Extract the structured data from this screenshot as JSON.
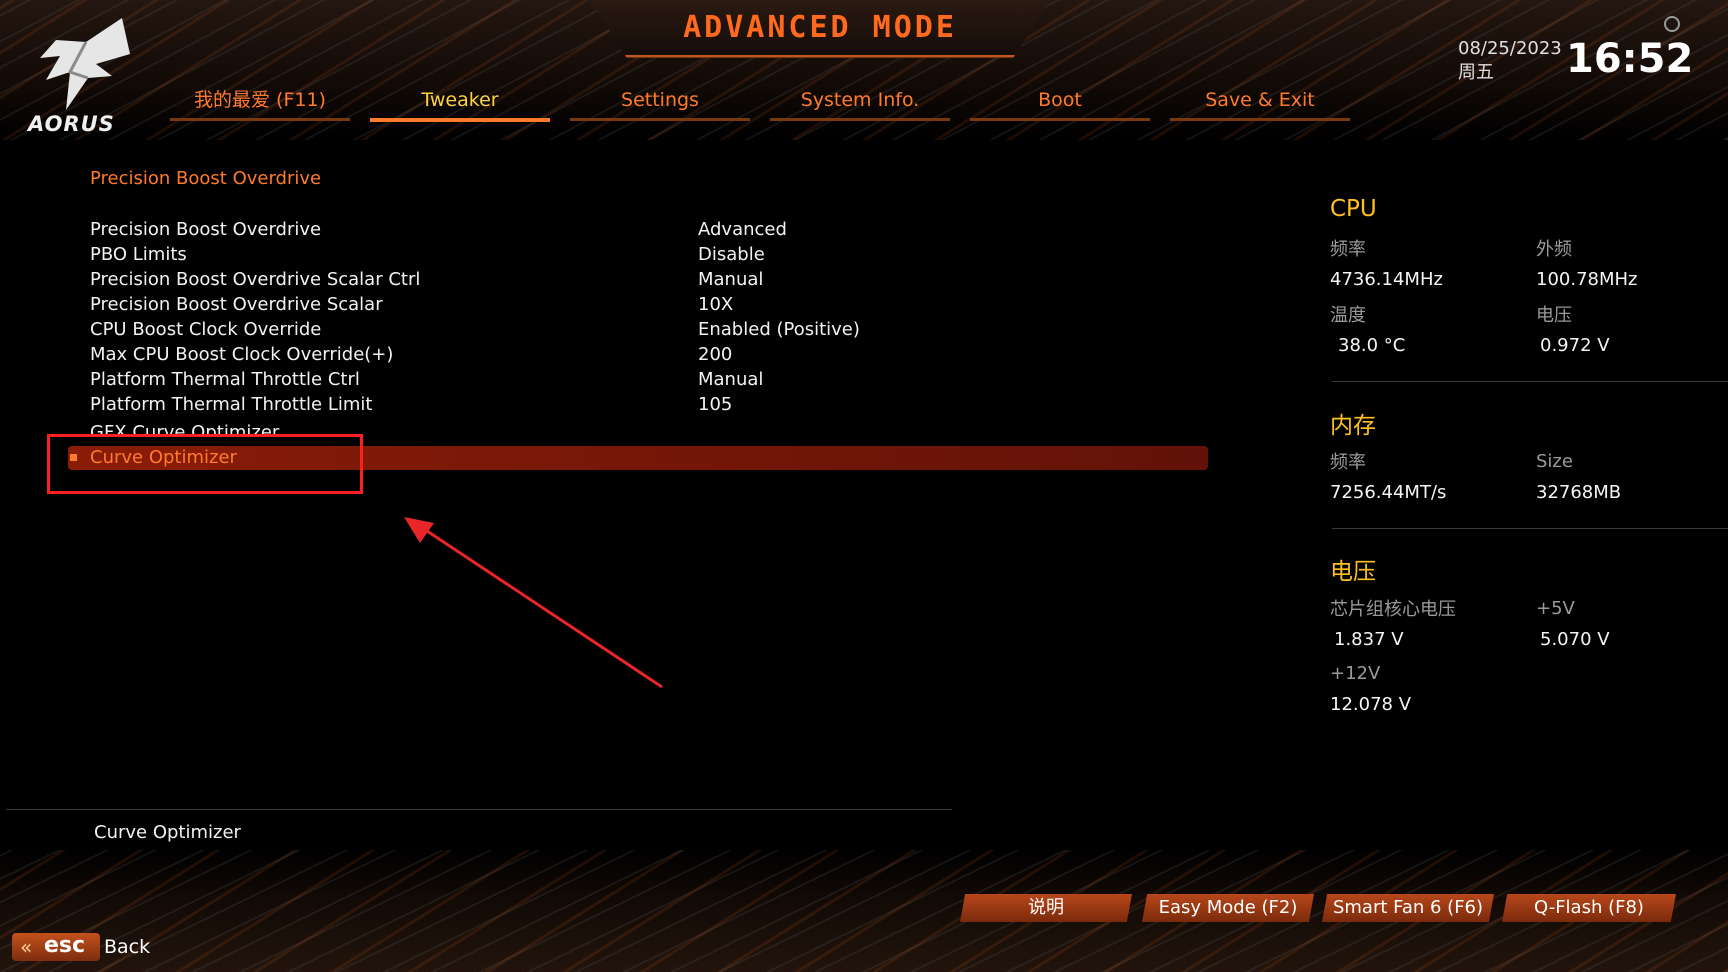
{
  "header": {
    "mode_title": "ADVANCED MODE",
    "logo_text": "AORUS",
    "date": "08/25/2023",
    "weekday": "周五",
    "time": "16:52"
  },
  "tabs": [
    {
      "label": "我的最爱 (F11)",
      "active": false
    },
    {
      "label": "Tweaker",
      "active": true
    },
    {
      "label": "Settings",
      "active": false
    },
    {
      "label": "System Info.",
      "active": false
    },
    {
      "label": "Boot",
      "active": false
    },
    {
      "label": "Save & Exit",
      "active": false
    }
  ],
  "main": {
    "section_title": "Precision Boost Overdrive",
    "rows": [
      {
        "label": "Precision Boost Overdrive",
        "value": "Advanced"
      },
      {
        "label": "PBO Limits",
        "value": "Disable"
      },
      {
        "label": "Precision Boost Overdrive Scalar Ctrl",
        "value": "Manual"
      },
      {
        "label": "Precision Boost Overdrive Scalar",
        "value": "10X"
      },
      {
        "label": "CPU Boost Clock Override",
        "value": "Enabled (Positive)"
      },
      {
        "label": "Max CPU Boost Clock Override(+)",
        "value": "200"
      },
      {
        "label": "Platform Thermal Throttle Ctrl",
        "value": "Manual"
      },
      {
        "label": "Platform Thermal Throttle Limit",
        "value": "105"
      }
    ],
    "submenu_partial": "GFX Curve Optimizer",
    "selected_item": "Curve Optimizer",
    "description": "Curve Optimizer"
  },
  "monitor": {
    "cpu": {
      "heading": "CPU",
      "freq_label": "频率",
      "freq_value": "4736.14MHz",
      "bclk_label": "外频",
      "bclk_value": "100.78MHz",
      "temp_label": "温度",
      "temp_value": "38.0 °C",
      "volt_label": "电压",
      "volt_value": "0.972 V"
    },
    "memory": {
      "heading": "内存",
      "freq_label": "频率",
      "freq_value": "7256.44MT/s",
      "size_label": "Size",
      "size_value": "32768MB"
    },
    "voltage": {
      "heading": "电压",
      "chipset_label": "芯片组核心电压",
      "chipset_value": "1.837 V",
      "v5_label": "+5V",
      "v5_value": "5.070 V",
      "v12_label": "+12V",
      "v12_value": "12.078 V"
    }
  },
  "footer": {
    "buttons": [
      "说明",
      "Easy Mode (F2)",
      "Smart Fan 6 (F6)",
      "Q-Flash (F8)"
    ],
    "esc_label": "esc",
    "back_label": "Back"
  },
  "colors": {
    "accent": "#ff7a2a",
    "active_tab": "#ffd23c",
    "monitor_heading": "#ffc020",
    "selection_bar": "#7a1a08",
    "annotation": "#ff1f1f"
  }
}
